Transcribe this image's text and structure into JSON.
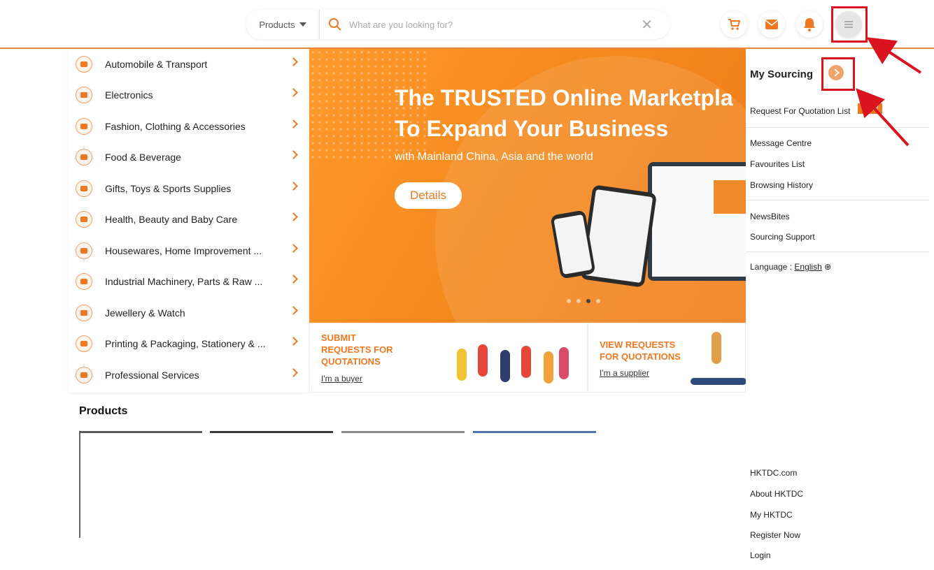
{
  "header": {
    "products_dropdown": "Products",
    "search_placeholder": "What are you looking for?",
    "clear_glyph": "✕",
    "icons": [
      "cart-icon",
      "mail-icon",
      "bell-icon",
      "menu-icon"
    ]
  },
  "categories": [
    {
      "label": "Automobile & Transport",
      "icon": "car-icon"
    },
    {
      "label": "Electronics",
      "icon": "electronics-icon"
    },
    {
      "label": "Fashion, Clothing & Accessories",
      "icon": "fashion-icon"
    },
    {
      "label": "Food & Beverage",
      "icon": "food-icon"
    },
    {
      "label": "Gifts, Toys & Sports Supplies",
      "icon": "gift-icon"
    },
    {
      "label": "Health, Beauty and Baby Care",
      "icon": "health-icon"
    },
    {
      "label": "Housewares, Home Improvement ...",
      "icon": "home-icon"
    },
    {
      "label": "Industrial Machinery, Parts & Raw ...",
      "icon": "tools-icon"
    },
    {
      "label": "Jewellery & Watch",
      "icon": "jewellery-icon"
    },
    {
      "label": "Printing & Packaging, Stationery & ...",
      "icon": "pen-icon"
    },
    {
      "label": "Professional Services",
      "icon": "briefcase-icon"
    }
  ],
  "hero": {
    "title_line1": "The TRUSTED Online Marketpla",
    "title_line2": "To Expand Your Business",
    "subtitle": "with Mainland China, Asia and the world",
    "button": "Details"
  },
  "promos": [
    {
      "title_lines": [
        "SUBMIT",
        "REQUESTS FOR",
        "QUOTATIONS"
      ],
      "link": "I'm a buyer"
    },
    {
      "title_lines": [
        "VIEW REQUESTS",
        "FOR QUOTATIONS"
      ],
      "link": "I'm a supplier"
    }
  ],
  "panel": {
    "title": "My Sourcing",
    "rfq": "Request For Quotation List",
    "badge": "NEW",
    "items_group1": [
      "Message Centre",
      "Favourites List",
      "Browsing History"
    ],
    "items_group2": [
      "NewsBites",
      "Sourcing Support"
    ],
    "language_label": "Language :",
    "language_value": "English",
    "footer_links": [
      "HKTDC.com",
      "About HKTDC",
      "My HKTDC",
      "Register Now",
      "Login"
    ]
  },
  "products_section": {
    "title": "Products"
  },
  "colors": {
    "accent": "#f07820",
    "annotation": "#d9141e"
  }
}
